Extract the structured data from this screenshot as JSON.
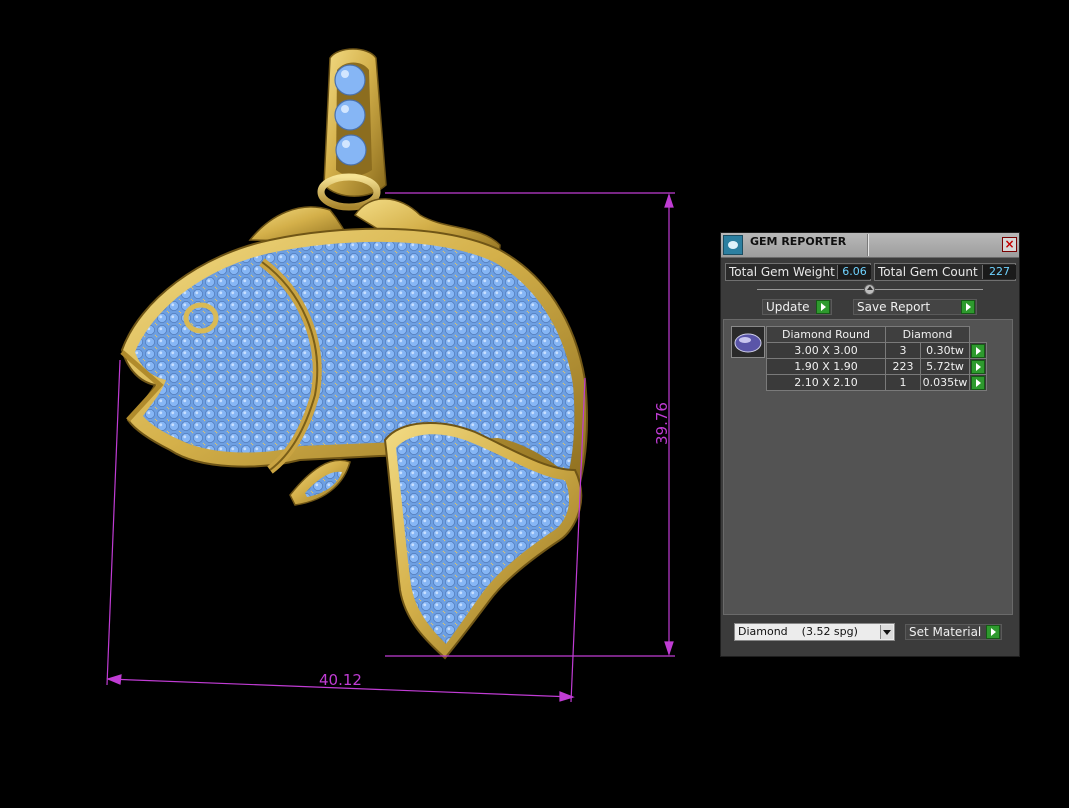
{
  "viewport": {
    "dimension_bottom": "40.12",
    "dimension_right": "39.76",
    "metal_color": "#d4b04a",
    "gem_color": "#7fb2f5",
    "dimension_color": "#c03cd4"
  },
  "gem_reporter": {
    "title": "GEM REPORTER",
    "total_gem_weight_label": "Total Gem Weight",
    "total_gem_weight_value": "6.06",
    "total_gem_count_label": "Total Gem Count",
    "total_gem_count_value": "227",
    "update_label": "Update",
    "save_report_label": "Save Report",
    "table": {
      "headers": [
        "Diamond Round",
        "Diamond"
      ],
      "rows": [
        {
          "size": "3.00 X 3.00",
          "count": "3",
          "weight": "0.30tw"
        },
        {
          "size": "1.90 X 1.90",
          "count": "223",
          "weight": "5.72tw"
        },
        {
          "size": "2.10 X 2.10",
          "count": "1",
          "weight": "0.035tw"
        }
      ]
    },
    "material_select_value": "Diamond    (3.52 spg)",
    "set_material_label": "Set Material"
  }
}
